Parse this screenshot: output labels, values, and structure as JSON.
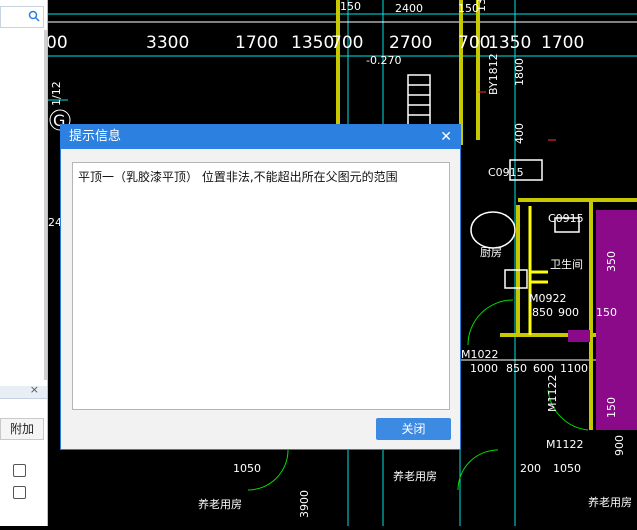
{
  "dialog": {
    "title": "提示信息",
    "message": "平顶一（乳胶漆平顶） 位置非法,不能超出所在父图元的范围",
    "close_button_label": "关闭"
  },
  "left_panel": {
    "column_header": "附加"
  },
  "cad": {
    "top_dims": [
      "00",
      "3300",
      "1700",
      "1350",
      "700",
      "2700",
      "700",
      "1350",
      "1700"
    ],
    "top_small": [
      "150",
      "2400",
      "150",
      "1300"
    ],
    "elevation": "-0.270",
    "axis_labels": [
      "1/12",
      "G",
      "24"
    ],
    "room_codes": [
      "BY1812",
      "C0915",
      "C0915",
      "M0922",
      "M1022",
      "M1122",
      "M1122"
    ],
    "room_names": [
      "卫生间",
      "厨房"
    ],
    "bottom_dims_right": [
      "1000",
      "850",
      "600",
      "1100"
    ],
    "vertical_dims": [
      "1800",
      "400",
      "150",
      "3900",
      "350",
      "150"
    ],
    "row_dims": [
      "850",
      "900",
      "150"
    ],
    "lower_dims": [
      "1050",
      "200",
      "1050",
      "900"
    ],
    "room_name_lower": "养老用房"
  }
}
